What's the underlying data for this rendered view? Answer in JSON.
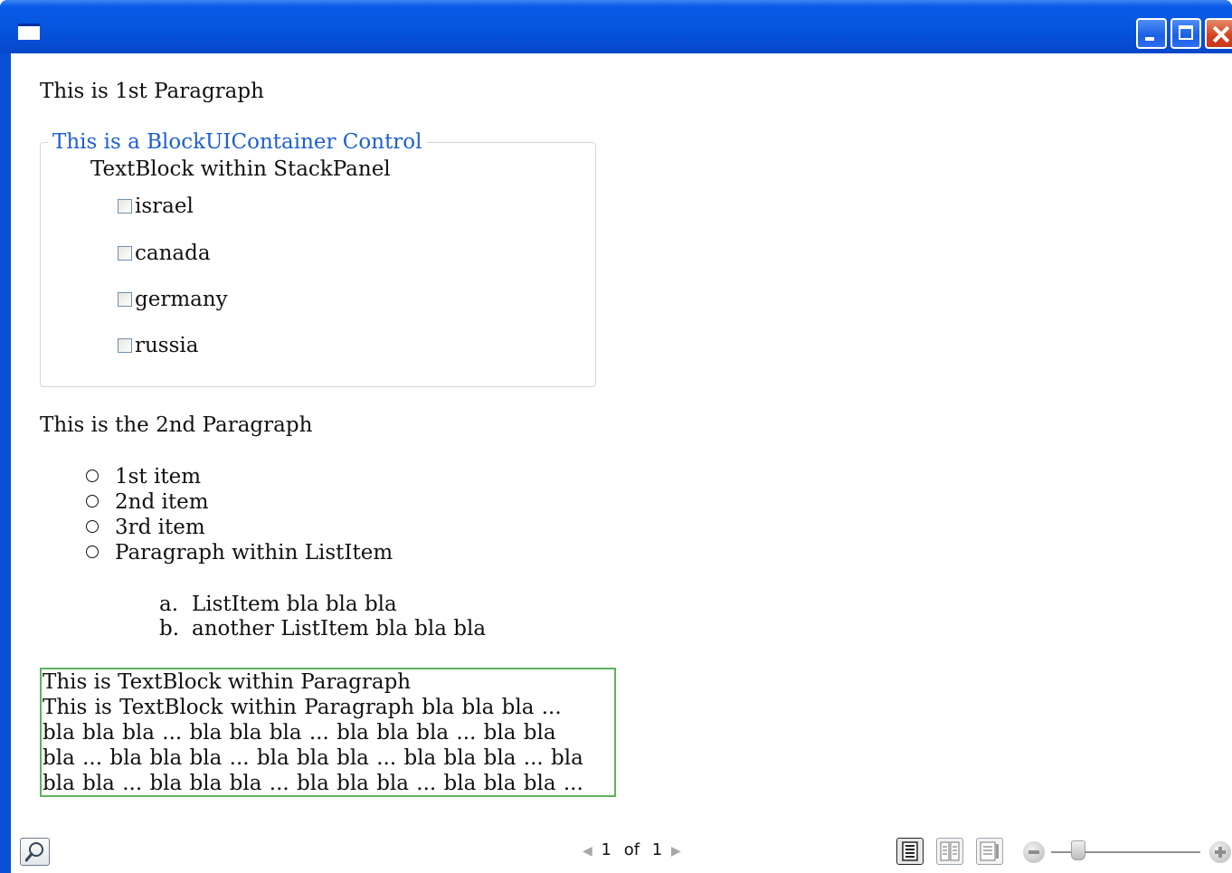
{
  "window": {
    "title": "",
    "icon": "window-icon",
    "controls": [
      "minimize-icon",
      "maximize-icon",
      "close-icon"
    ],
    "frame_color": "#0a4fd8"
  },
  "document": {
    "para1": "This is 1st Paragraph",
    "block_ui": {
      "legend": "This is a BlockUIContainer Control",
      "legend_color": "#1d5fd4",
      "stack_title": "TextBlock within StackPanel",
      "countries": [
        "israel",
        "canada",
        "germany",
        "russia"
      ]
    },
    "para2": "This is the 2nd Paragraph",
    "bullets": [
      "1st item",
      "2nd item",
      "3rd item",
      "Paragraph within ListItem"
    ],
    "sublist": [
      {
        "marker": "a.",
        "text": "ListItem bla bla bla"
      },
      {
        "marker": "b.",
        "text": "another ListItem bla bla bla"
      }
    ],
    "textblock": {
      "line1": "This is TextBlock within Paragraph",
      "body": "This is TextBlock within Paragraph bla bla bla ... bla bla bla ... bla bla bla ... bla bla bla ... bla bla bla ... bla bla bla ... bla bla bla ... bla bla bla ... bla bla bla ... bla bla bla ... bla bla bla ... bla bla bla ...",
      "border_color": "#5cb35c"
    }
  },
  "toolbar": {
    "find_icon": "search-icon",
    "page_current": "1",
    "page_of": "of",
    "page_total": "1",
    "view_modes": [
      "single-page-icon",
      "two-page-icon",
      "scroll-page-icon"
    ],
    "active_view_mode": 0,
    "zoom_fraction": 0.15
  }
}
